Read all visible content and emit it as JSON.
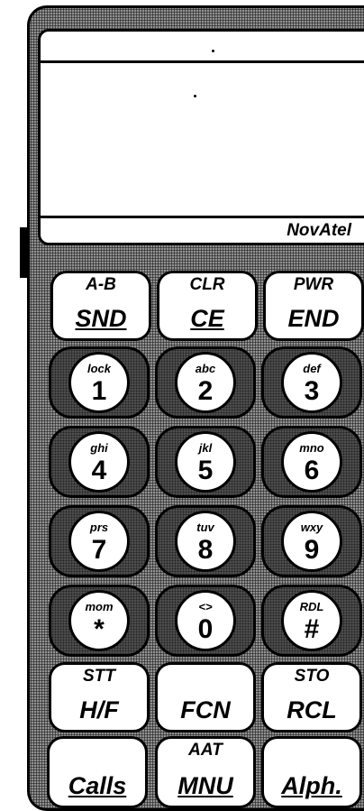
{
  "brand": "NovAtel",
  "function_keys_top": [
    {
      "top": "A-B",
      "main": "SND"
    },
    {
      "top": "CLR",
      "main": "CE"
    },
    {
      "top": "PWR",
      "main": "END"
    }
  ],
  "number_keys": [
    {
      "sub": "lock",
      "digit": "1"
    },
    {
      "sub": "abc",
      "digit": "2"
    },
    {
      "sub": "def",
      "digit": "3"
    },
    {
      "sub": "ghi",
      "digit": "4"
    },
    {
      "sub": "jkl",
      "digit": "5"
    },
    {
      "sub": "mno",
      "digit": "6"
    },
    {
      "sub": "prs",
      "digit": "7"
    },
    {
      "sub": "tuv",
      "digit": "8"
    },
    {
      "sub": "wxy",
      "digit": "9"
    },
    {
      "sub": "mom",
      "digit": "*"
    },
    {
      "sub": "<>",
      "digit": "0"
    },
    {
      "sub": "RDL",
      "digit": "#"
    }
  ],
  "function_keys_bottom": [
    {
      "top": "STT",
      "main": "H/F"
    },
    {
      "top": "",
      "main": "FCN"
    },
    {
      "top": "STO",
      "main": "RCL"
    },
    {
      "top": "",
      "main": "Calls"
    },
    {
      "top": "AAT",
      "main": "MNU"
    },
    {
      "top": "",
      "main": "Alph."
    }
  ]
}
